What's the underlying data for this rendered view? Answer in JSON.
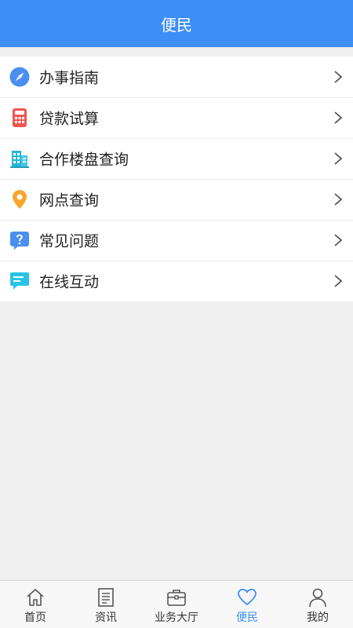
{
  "header": {
    "title": "便民"
  },
  "menu": {
    "items": [
      {
        "label": "办事指南",
        "icon": "compass-icon"
      },
      {
        "label": "贷款试算",
        "icon": "calculator-icon"
      },
      {
        "label": "合作楼盘查询",
        "icon": "building-icon"
      },
      {
        "label": "网点查询",
        "icon": "location-pin-icon"
      },
      {
        "label": "常见问题",
        "icon": "question-icon"
      },
      {
        "label": "在线互动",
        "icon": "chat-icon"
      }
    ]
  },
  "tabbar": {
    "active_color": "#3e8ef7",
    "tabs": [
      {
        "label": "首页",
        "icon": "home-icon",
        "active": false
      },
      {
        "label": "资讯",
        "icon": "news-icon",
        "active": false
      },
      {
        "label": "业务大厅",
        "icon": "briefcase-icon",
        "active": false
      },
      {
        "label": "便民",
        "icon": "heart-icon",
        "active": true
      },
      {
        "label": "我的",
        "icon": "user-icon",
        "active": false
      }
    ]
  },
  "colors": {
    "brand": "#3e8ef7",
    "background": "#efefef"
  }
}
